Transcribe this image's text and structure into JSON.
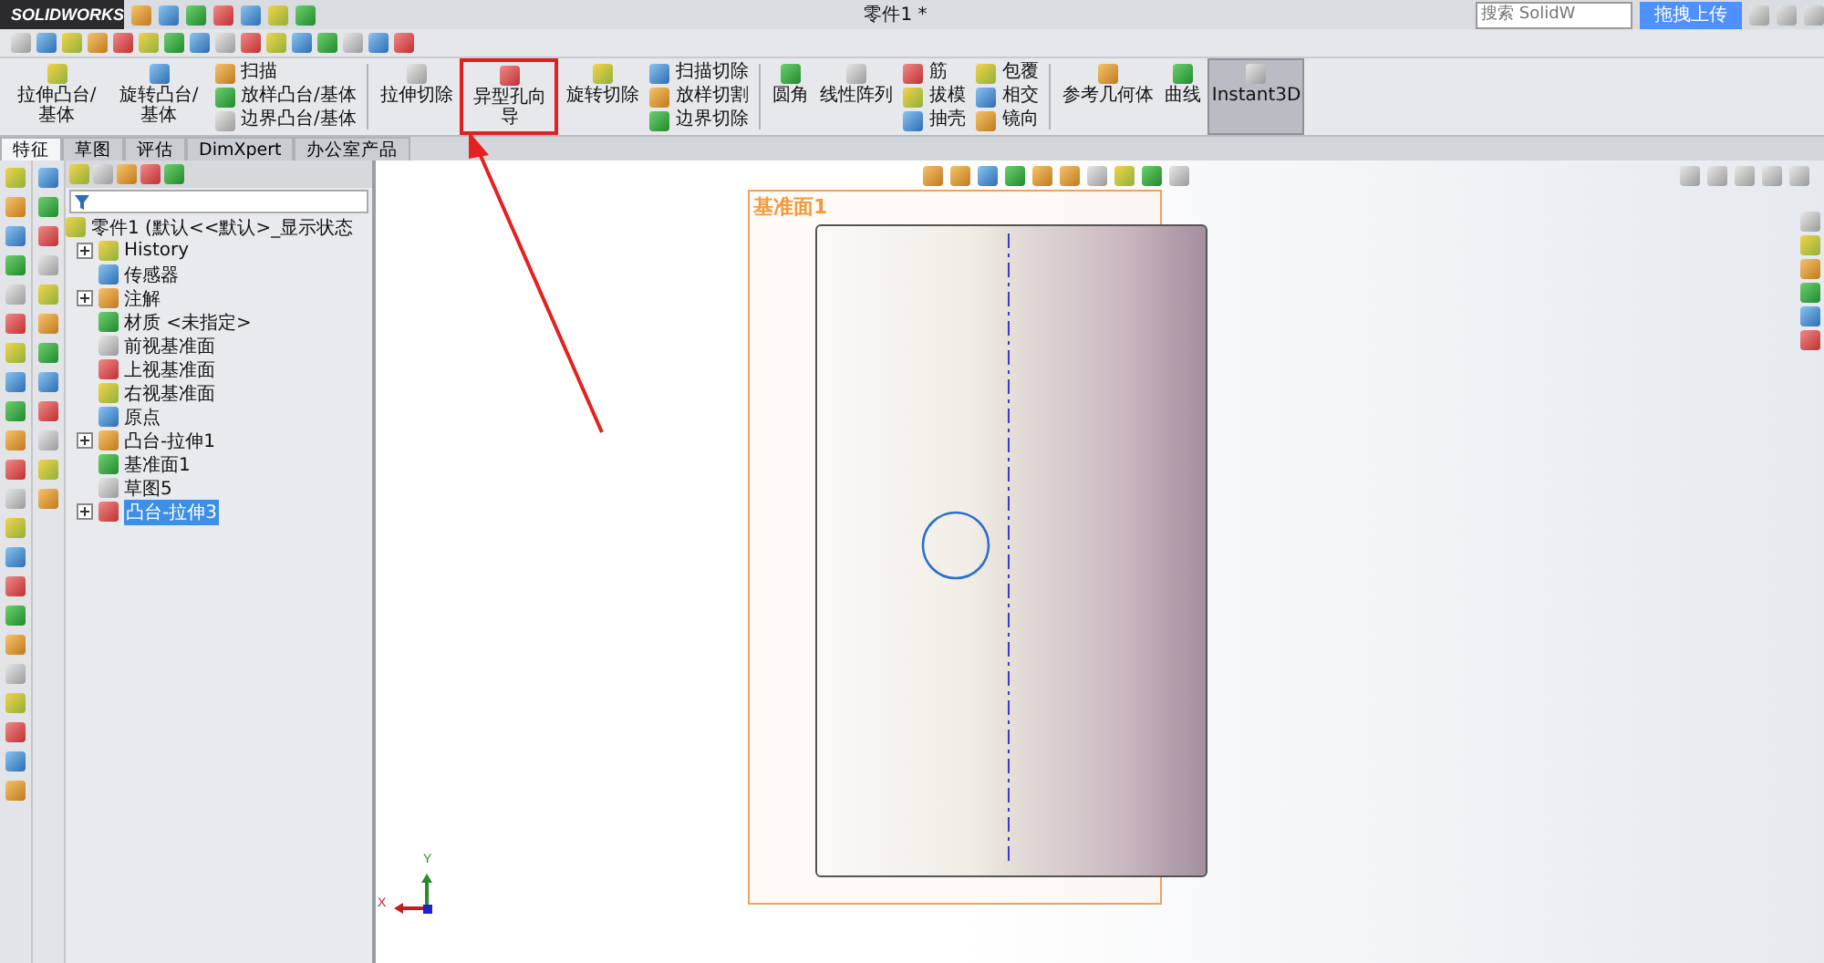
{
  "title_bar": {
    "logo": "SOLIDWORKS",
    "document_title": "零件1 *",
    "search": {
      "placeholder": "搜索 SolidW"
    },
    "upload_button": "拖拽上传"
  },
  "ribbon": [
    {
      "kind": "large",
      "label": "拉伸凸台/基体",
      "highlighted": false,
      "pressed": false
    },
    {
      "kind": "large",
      "label": "旋转凸台/基体",
      "highlighted": false,
      "pressed": false
    },
    {
      "kind": "stack",
      "items": [
        "扫描",
        "放样凸台/基体",
        "边界凸台/基体"
      ]
    },
    {
      "kind": "separator"
    },
    {
      "kind": "large",
      "label": "拉伸切除",
      "highlighted": false,
      "pressed": false
    },
    {
      "kind": "large",
      "label": "异型孔向导",
      "highlighted": true,
      "pressed": false
    },
    {
      "kind": "large",
      "label": "旋转切除",
      "highlighted": false,
      "pressed": false
    },
    {
      "kind": "stack",
      "items": [
        "扫描切除",
        "放样切割",
        "边界切除"
      ]
    },
    {
      "kind": "separator"
    },
    {
      "kind": "large",
      "label": "圆角",
      "highlighted": false,
      "pressed": false
    },
    {
      "kind": "large",
      "label": "线性阵列",
      "highlighted": false,
      "pressed": false
    },
    {
      "kind": "stack",
      "items": [
        "筋",
        "拔模",
        "抽壳"
      ]
    },
    {
      "kind": "stack",
      "items": [
        "包覆",
        "相交",
        "镜向"
      ]
    },
    {
      "kind": "separator"
    },
    {
      "kind": "large",
      "label": "参考几何体",
      "highlighted": false,
      "pressed": false
    },
    {
      "kind": "large",
      "label": "曲线",
      "highlighted": false,
      "pressed": false
    },
    {
      "kind": "large",
      "label": "Instant3D",
      "highlighted": false,
      "pressed": true
    }
  ],
  "tabs": [
    {
      "label": "特征",
      "selected": true
    },
    {
      "label": "草图",
      "selected": false
    },
    {
      "label": "评估",
      "selected": false
    },
    {
      "label": "DimXpert",
      "selected": false
    },
    {
      "label": "办公室产品",
      "selected": false
    }
  ],
  "feature_tree": {
    "root": "零件1 (默认<<默认>_显示状态",
    "items": [
      {
        "label": "History",
        "expandable": true,
        "selected": false
      },
      {
        "label": "传感器",
        "expandable": false,
        "selected": false
      },
      {
        "label": "注解",
        "expandable": true,
        "selected": false
      },
      {
        "label": "材质 <未指定>",
        "expandable": false,
        "selected": false
      },
      {
        "label": "前视基准面",
        "expandable": false,
        "selected": false
      },
      {
        "label": "上视基准面",
        "expandable": false,
        "selected": false
      },
      {
        "label": "右视基准面",
        "expandable": false,
        "selected": false
      },
      {
        "label": "原点",
        "expandable": false,
        "selected": false
      },
      {
        "label": "凸台-拉伸1",
        "expandable": true,
        "selected": false
      },
      {
        "label": "基准面1",
        "expandable": false,
        "selected": false
      },
      {
        "label": "草图5",
        "expandable": false,
        "selected": false
      },
      {
        "label": "凸台-拉伸3",
        "expandable": true,
        "selected": true
      }
    ]
  },
  "viewport": {
    "plane_label": "基准面1",
    "triad": {
      "y_label": "Y",
      "x_label": "X"
    }
  }
}
